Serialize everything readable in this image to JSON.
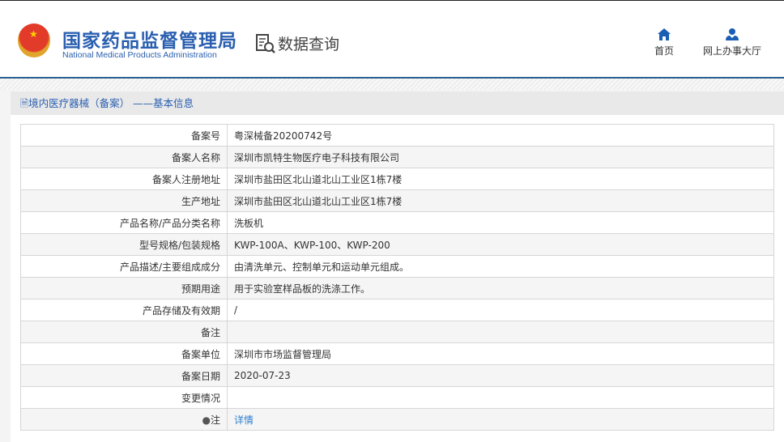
{
  "header": {
    "title_cn": "国家药品监督管理局",
    "title_en": "National Medical Products Administration",
    "query": "数据查询",
    "nav": [
      {
        "label": "首页",
        "icon": "home-icon"
      },
      {
        "label": "网上办事大厅",
        "icon": "user-icon"
      }
    ]
  },
  "panel": {
    "title": "境内医疗器械（备案） ——基本信息"
  },
  "rows": [
    {
      "label": "备案号",
      "value": "粤深械备20200742号"
    },
    {
      "label": "备案人名称",
      "value": "深圳市凯特生物医疗电子科技有限公司"
    },
    {
      "label": "备案人注册地址",
      "value": "深圳市盐田区北山道北山工业区1栋7楼"
    },
    {
      "label": "生产地址",
      "value": "深圳市盐田区北山道北山工业区1栋7楼"
    },
    {
      "label": "产品名称/产品分类名称",
      "value": "洗板机"
    },
    {
      "label": "型号规格/包装规格",
      "value": "KWP-100A、KWP-100、KWP-200"
    },
    {
      "label": "产品描述/主要组成成分",
      "value": "由清洗单元、控制单元和运动单元组成。"
    },
    {
      "label": "预期用途",
      "value": "用于实验室样品板的洗涤工作。"
    },
    {
      "label": "产品存储及有效期",
      "value": "/"
    },
    {
      "label": "备注",
      "value": ""
    },
    {
      "label": "备案单位",
      "value": "深圳市市场监督管理局"
    },
    {
      "label": "备案日期",
      "value": "2020-07-23"
    },
    {
      "label": "变更情况",
      "value": ""
    },
    {
      "label": "注",
      "value": "详情"
    }
  ]
}
